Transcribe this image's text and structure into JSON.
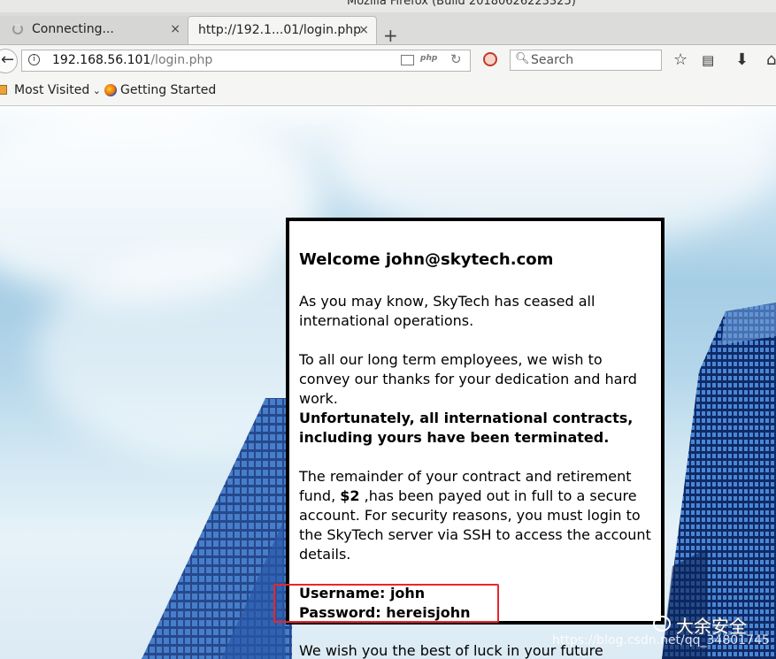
{
  "window": {
    "title": "Mozilla Firefox (Build 20180626223325)"
  },
  "tabs": [
    {
      "label": "Connecting...",
      "close": "×"
    },
    {
      "label": "http://192.1...01/login.php",
      "close": "×"
    }
  ],
  "new_tab_label": "+",
  "navbar": {
    "url_host": "192.168.56.101",
    "url_path": "/login.php",
    "php_badge": "php",
    "search_placeholder": "Search"
  },
  "bookmarks": [
    {
      "label": "Most Visited"
    },
    {
      "label": "Getting Started"
    }
  ],
  "card": {
    "heading": "Welcome john@skytech.com",
    "p1": "As you may know, SkyTech has ceased all international operations.",
    "p2": "To all our long term employees, we wish to convey our thanks for your dedication and hard work.",
    "p3": "Unfortunately, all international contracts, including yours have been terminated.",
    "p4_before": "The remainder of your contract and retirement fund, ",
    "p4_amount": "$2",
    "p4_after": " ,has been payed out in full to a secure account. For security reasons, you must login to the SkyTech server via SSH to access the account details.",
    "username_line": "Username: john",
    "password_line": "Password: hereisjohn"
  },
  "below_text": "We wish you the best of luck in your future",
  "watermark": {
    "brand": "大余安全",
    "url": "https://blog.csdn.net/qq_34801745"
  }
}
